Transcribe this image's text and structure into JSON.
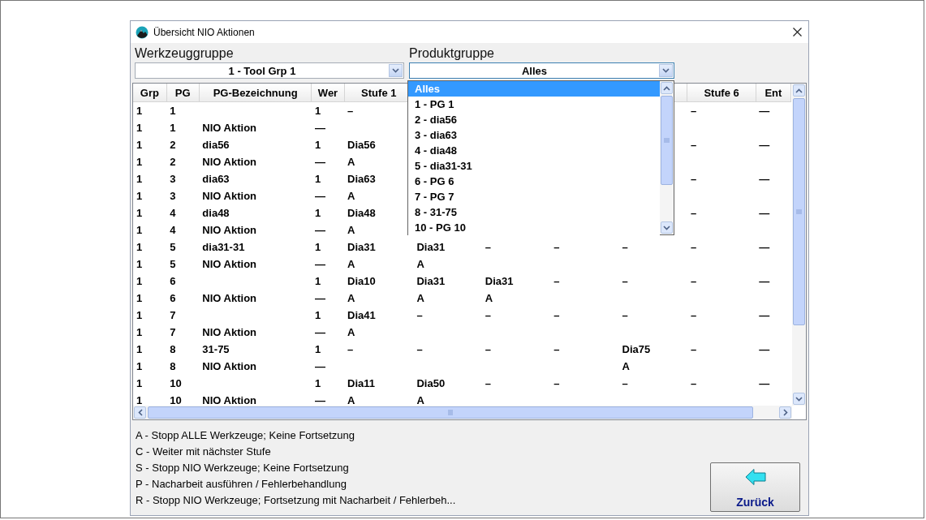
{
  "window": {
    "title": "Übersicht NIO Aktionen"
  },
  "filters": [
    {
      "label": "Werkzeuggruppe",
      "value": "1 - Tool Grp 1",
      "open": false
    },
    {
      "label": "Produktgruppe",
      "value": "Alles",
      "open": true,
      "options": [
        {
          "label": "Alles",
          "selected": true
        },
        {
          "label": "1 - PG 1",
          "selected": false
        },
        {
          "label": "2 - dia56",
          "selected": false
        },
        {
          "label": "3 - dia63",
          "selected": false
        },
        {
          "label": "4 - dia48",
          "selected": false
        },
        {
          "label": "5 - dia31-31",
          "selected": false
        },
        {
          "label": "6 - PG 6",
          "selected": false
        },
        {
          "label": "7 - PG 7",
          "selected": false
        },
        {
          "label": "8 - 31-75",
          "selected": false
        },
        {
          "label": "10 - PG 10",
          "selected": false
        }
      ]
    }
  ],
  "table": {
    "columns": [
      "Grp",
      "PG",
      "PG-Bezeichnung",
      "Wer",
      "Stufe 1",
      null,
      null,
      null,
      null,
      "Stufe 6",
      "Ent"
    ],
    "rows": [
      [
        "1",
        "1",
        null,
        "1",
        "–",
        null,
        null,
        null,
        null,
        "–",
        "—"
      ],
      [
        "1",
        "1",
        "NIO Aktion",
        "—",
        null,
        null,
        null,
        null,
        null,
        null,
        null
      ],
      [
        "1",
        "2",
        "dia56",
        "1",
        "Dia56",
        null,
        null,
        null,
        null,
        "–",
        "—"
      ],
      [
        "1",
        "2",
        "NIO Aktion",
        "—",
        "A",
        null,
        null,
        null,
        null,
        null,
        null
      ],
      [
        "1",
        "3",
        "dia63",
        "1",
        "Dia63",
        null,
        null,
        null,
        null,
        "–",
        "—"
      ],
      [
        "1",
        "3",
        "NIO Aktion",
        "—",
        "A",
        null,
        null,
        null,
        null,
        null,
        null
      ],
      [
        "1",
        "4",
        "dia48",
        "1",
        "Dia48",
        null,
        null,
        null,
        null,
        "–",
        "—"
      ],
      [
        "1",
        "4",
        "NIO Aktion",
        "—",
        "A",
        null,
        null,
        null,
        null,
        null,
        null
      ],
      [
        "1",
        "5",
        "dia31-31",
        "1",
        "Dia31",
        "Dia31",
        "–",
        "–",
        "–",
        "–",
        "—"
      ],
      [
        "1",
        "5",
        "NIO Aktion",
        "—",
        "A",
        "A",
        null,
        null,
        null,
        null,
        null
      ],
      [
        "1",
        "6",
        null,
        "1",
        "Dia10",
        "Dia31",
        "Dia31",
        "–",
        "–",
        "–",
        "—"
      ],
      [
        "1",
        "6",
        "NIO Aktion",
        "—",
        "A",
        "A",
        "A",
        null,
        null,
        null,
        null
      ],
      [
        "1",
        "7",
        null,
        "1",
        "Dia41",
        "–",
        "–",
        "–",
        "–",
        "–",
        "—"
      ],
      [
        "1",
        "7",
        "NIO Aktion",
        "—",
        "A",
        null,
        null,
        null,
        null,
        null,
        null
      ],
      [
        "1",
        "8",
        "31-75",
        "1",
        "–",
        "–",
        "–",
        "–",
        "Dia75",
        "–",
        "—"
      ],
      [
        "1",
        "8",
        "NIO Aktion",
        "—",
        null,
        null,
        null,
        null,
        "A",
        null,
        null
      ],
      [
        "1",
        "10",
        null,
        "1",
        "Dia11",
        "Dia50",
        "–",
        "–",
        "–",
        "–",
        "—"
      ],
      [
        "1",
        "10",
        "NIO Aktion",
        "—",
        "A",
        "A",
        null,
        null,
        null,
        null,
        null
      ]
    ]
  },
  "legend": [
    "A - Stopp ALLE Werkzeuge; Keine Fortsetzung",
    "C - Weiter mit nächster Stufe",
    "S - Stopp NIO Werkzeuge; Keine Fortsetzung",
    "P - Nacharbeit ausführen / Fehlerbehandlung",
    "R - Stopp NIO Werkzeuge; Fortsetzung mit Nacharbeit / Fehlerbeh..."
  ],
  "buttons": [
    {
      "label": "Zurück"
    }
  ]
}
